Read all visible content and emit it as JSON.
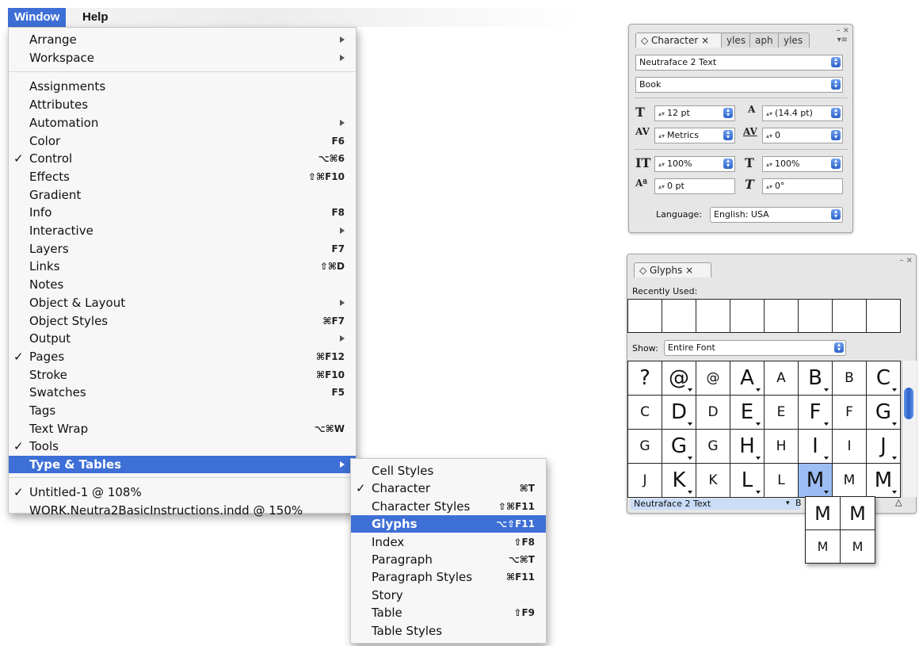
{
  "menubar": {
    "window": "Window",
    "help": "Help"
  },
  "window_menu": {
    "items": [
      {
        "label": "Arrange",
        "check": "",
        "shortcut": "",
        "submenu": true
      },
      {
        "label": "Workspace",
        "check": "",
        "shortcut": "",
        "submenu": true
      },
      {
        "label": "Assignments",
        "check": "",
        "shortcut": "",
        "submenu": false
      },
      {
        "label": "Attributes",
        "check": "",
        "shortcut": "",
        "submenu": false
      },
      {
        "label": "Automation",
        "check": "",
        "shortcut": "",
        "submenu": true
      },
      {
        "label": "Color",
        "check": "",
        "shortcut": "F6",
        "submenu": false
      },
      {
        "label": "Control",
        "check": "✓",
        "shortcut": "⌥⌘6",
        "submenu": false
      },
      {
        "label": "Effects",
        "check": "",
        "shortcut": "⇧⌘F10",
        "submenu": false
      },
      {
        "label": "Gradient",
        "check": "",
        "shortcut": "",
        "submenu": false
      },
      {
        "label": "Info",
        "check": "",
        "shortcut": "F8",
        "submenu": false
      },
      {
        "label": "Interactive",
        "check": "",
        "shortcut": "",
        "submenu": true
      },
      {
        "label": "Layers",
        "check": "",
        "shortcut": "F7",
        "submenu": false
      },
      {
        "label": "Links",
        "check": "",
        "shortcut": "⇧⌘D",
        "submenu": false
      },
      {
        "label": "Notes",
        "check": "",
        "shortcut": "",
        "submenu": false
      },
      {
        "label": "Object & Layout",
        "check": "",
        "shortcut": "",
        "submenu": true
      },
      {
        "label": "Object Styles",
        "check": "",
        "shortcut": "⌘F7",
        "submenu": false
      },
      {
        "label": "Output",
        "check": "",
        "shortcut": "",
        "submenu": true
      },
      {
        "label": "Pages",
        "check": "✓",
        "shortcut": "⌘F12",
        "submenu": false
      },
      {
        "label": "Stroke",
        "check": "",
        "shortcut": "⌘F10",
        "submenu": false
      },
      {
        "label": "Swatches",
        "check": "",
        "shortcut": "F5",
        "submenu": false
      },
      {
        "label": "Tags",
        "check": "",
        "shortcut": "",
        "submenu": false
      },
      {
        "label": "Text Wrap",
        "check": "",
        "shortcut": "⌥⌘W",
        "submenu": false
      },
      {
        "label": "Tools",
        "check": "✓",
        "shortcut": "",
        "submenu": false
      },
      {
        "label": "Type & Tables",
        "check": "",
        "shortcut": "",
        "submenu": true,
        "selected": true
      }
    ],
    "documents": [
      {
        "label": "Untitled-1 @ 108%",
        "check": "✓"
      },
      {
        "label": "WORK.Neutra2BasicInstructions.indd @ 150%",
        "check": ""
      }
    ]
  },
  "submenu": {
    "items": [
      {
        "label": "Cell Styles",
        "check": "",
        "shortcut": ""
      },
      {
        "label": "Character",
        "check": "✓",
        "shortcut": "⌘T"
      },
      {
        "label": "Character Styles",
        "check": "",
        "shortcut": "⇧⌘F11"
      },
      {
        "label": "Glyphs",
        "check": "",
        "shortcut": "⌥⇧F11",
        "selected": true
      },
      {
        "label": "Index",
        "check": "",
        "shortcut": "⇧F8"
      },
      {
        "label": "Paragraph",
        "check": "",
        "shortcut": "⌥⌘T"
      },
      {
        "label": "Paragraph Styles",
        "check": "",
        "shortcut": "⌘F11"
      },
      {
        "label": "Story",
        "check": "",
        "shortcut": ""
      },
      {
        "label": "Table",
        "check": "",
        "shortcut": "⇧F9"
      },
      {
        "label": "Table Styles",
        "check": "",
        "shortcut": ""
      }
    ]
  },
  "character_panel": {
    "tab": "◇ Character ×",
    "tab2": "yles",
    "tab3": "aph",
    "tab4": "yles",
    "font": "Neutraface 2 Text",
    "style": "Book",
    "size": "12 pt",
    "leading": "(14.4 pt)",
    "kerning": "Metrics",
    "tracking": "0",
    "vscale": "100%",
    "hscale": "100%",
    "baseline": "0 pt",
    "skew": "0°",
    "language_label": "Language:",
    "language": "English: USA"
  },
  "glyphs_panel": {
    "tab": "◇ Glyphs ×",
    "recently_used": "Recently Used:",
    "show_label": "Show:",
    "show_value": "Entire Font",
    "font": "Neutraface 2 Text",
    "style_abbrev": "B",
    "rows": [
      [
        "?",
        "@",
        "@",
        "A",
        "A",
        "B",
        "B",
        "C"
      ],
      [
        "C",
        "D",
        "D",
        "E",
        "E",
        "F",
        "F",
        "G"
      ],
      [
        "G",
        "G",
        "G",
        "H",
        "H",
        "I",
        "I",
        "J"
      ],
      [
        "J",
        "K",
        "K",
        "L",
        "L",
        "M",
        "M",
        "M"
      ]
    ],
    "popup": [
      [
        "M",
        "M"
      ],
      [
        "M",
        "M"
      ]
    ]
  }
}
